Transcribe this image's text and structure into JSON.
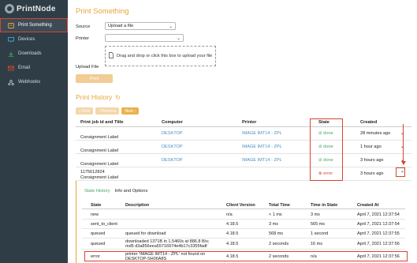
{
  "brand": {
    "name": "PrintNode"
  },
  "sidebar": {
    "items": [
      {
        "label": "Print Something",
        "icon": "print-icon",
        "active": true
      },
      {
        "label": "Devices",
        "icon": "monitor-icon",
        "active": false
      },
      {
        "label": "Downloads",
        "icon": "download-icon",
        "active": false
      },
      {
        "label": "Email",
        "icon": "envelope-icon",
        "active": false
      },
      {
        "label": "Webhooks",
        "icon": "webhook-icon",
        "active": false
      }
    ]
  },
  "form": {
    "title": "Print Something",
    "source_label": "Source",
    "source_value": "Upload a file",
    "printer_label": "Printer",
    "printer_value": "",
    "upload_label": "Upload File",
    "dropzone_text": "Drag and drop or click this box to upload your file",
    "submit_label": "Print"
  },
  "history": {
    "title": "Print History",
    "pager": {
      "first": "« First",
      "previous": "‹ Previous",
      "next": "Next ›"
    },
    "columns": {
      "title": "Print job id and Title",
      "computer": "Computer",
      "printer": "Printer",
      "state": "State",
      "created": "Created"
    },
    "rows": [
      {
        "title": "Consignment Label",
        "computer": "DESKTOP",
        "printer": "IMAGE IMT14 - ZPL",
        "state": "done",
        "created": "28 minutes ago"
      },
      {
        "title": "Consignment Label",
        "computer": "DESKTOP",
        "printer": "IMAGE IMT14 - ZPL",
        "state": "done",
        "created": "1 hour ago"
      },
      {
        "title": "Consignment Label",
        "computer": "DESKTOP",
        "printer": "IMAGE IMT14 - ZPL",
        "state": "done",
        "created": "3 hours ago"
      },
      {
        "job_id": "1175612824",
        "title": "Consignment Label",
        "computer": "DESKTOP",
        "printer": "IMAGE IMT14 - ZPL",
        "state": "error",
        "created": "3 hours ago"
      }
    ]
  },
  "details": {
    "tabs": [
      "State History",
      "Info and Options"
    ],
    "columns": {
      "state": "State",
      "description": "Description",
      "version": "Client Version",
      "time": "Total Time",
      "time_in_state": "Time in State",
      "created": "Created At"
    },
    "rows": [
      {
        "state": "new",
        "description": "",
        "version": "n/a",
        "time": "< 1 ms",
        "time_in_state": "3 ms",
        "created": "April 7, 2021 12:37:54"
      },
      {
        "state": "sent_to_client",
        "description": "",
        "version": "4.18.5",
        "time": "3 ms",
        "time_in_state": "565 ms",
        "created": "April 7, 2021 12:37:54"
      },
      {
        "state": "queued",
        "description": "queued for download",
        "version": "4.18.5",
        "time": "568 ms",
        "time_in_state": "1 second",
        "created": "April 7, 2021 12:37:55"
      },
      {
        "state": "queued",
        "description": "downloaded 1371B in 1.5460s at 886.8 B/s; md5 d3a856eea55716974e4b17c3355fadf",
        "version": "4.18.5",
        "time": "2 seconds",
        "time_in_state": "16 ms",
        "created": "April 7, 2021 12:37:56"
      },
      {
        "state": "error",
        "description": "printer 'IMAGE IMT14 - ZPL' not found on DESKTOP-SH06A8S",
        "version": "4.18.5",
        "time": "2 seconds",
        "time_in_state": "n/a",
        "created": "April 7, 2021 12:37:56"
      }
    ]
  },
  "colors": {
    "accent": "#e8a43b",
    "sidebar": "#2f3d47",
    "done": "#3da85c",
    "error": "#d9432f",
    "link": "#4a90c2",
    "annotation": "#d9432f"
  }
}
